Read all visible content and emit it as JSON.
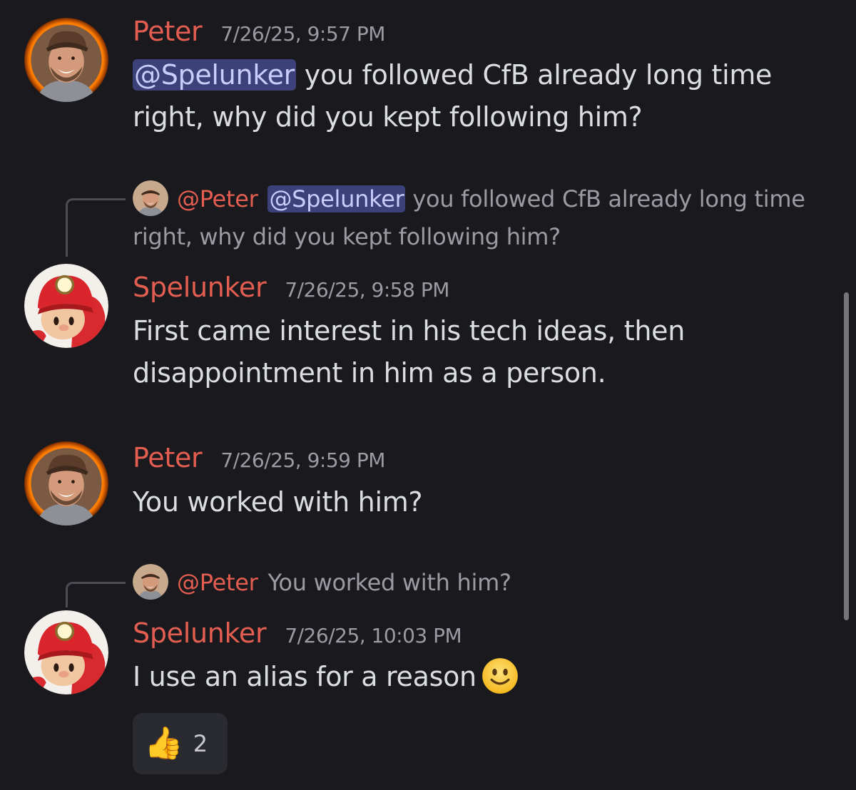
{
  "colors": {
    "background": "#1a1a1e",
    "peter_name": "#e35e50",
    "spelunker_name": "#e35e50",
    "mention_bg": "#3c4279",
    "mention_text": "#c9cdfb",
    "message_text": "#dbdee1",
    "timestamp_text": "#9a9ba3"
  },
  "messages": [
    {
      "author": "Peter",
      "timestamp": "7/26/25, 9:57 PM",
      "mention": "@Spelunker",
      "text": " you followed CfB already long time right, why did you kept following him?"
    },
    {
      "reply": {
        "author": "@Peter",
        "mention": "@Spelunker",
        "text": " you followed CfB already long time right, why did you kept following him?"
      },
      "author": "Spelunker",
      "timestamp": "7/26/25, 9:58 PM",
      "text": "First came interest in his tech ideas, then disappointment in him as a person."
    },
    {
      "author": "Peter",
      "timestamp": "7/26/25, 9:59 PM",
      "text": "You worked with him?"
    },
    {
      "reply": {
        "author": "@Peter",
        "text": "You worked with him?"
      },
      "author": "Spelunker",
      "timestamp": "7/26/25, 10:03 PM",
      "text": "I use an alias for a reason",
      "emoji": "slightly-smiling-face-icon",
      "reaction": {
        "emoji": "👍",
        "count": "2"
      }
    }
  ]
}
